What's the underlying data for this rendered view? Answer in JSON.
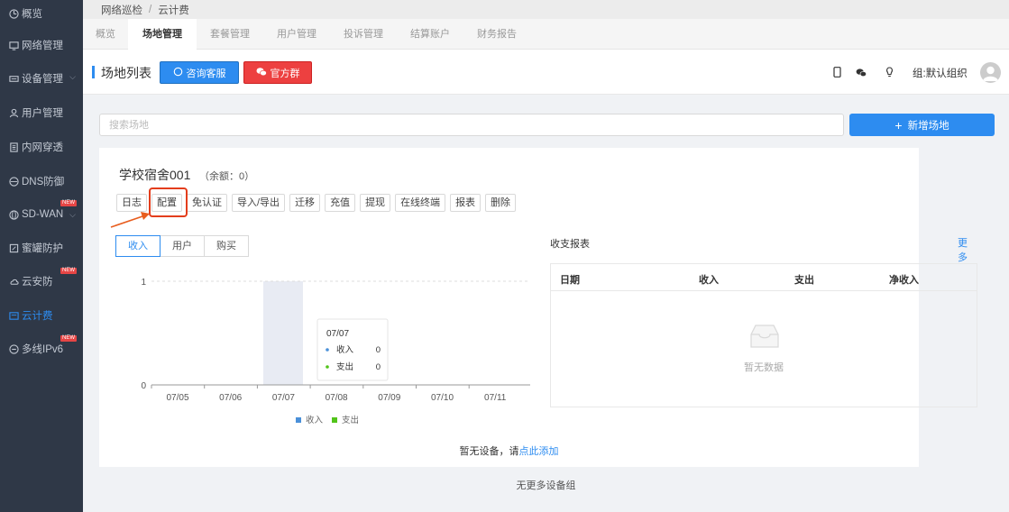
{
  "sidebar": {
    "items": [
      {
        "label": "概览",
        "icon": "dashboard-icon"
      },
      {
        "label": "网络管理",
        "icon": "monitor-icon"
      },
      {
        "label": "设备管理",
        "icon": "device-icon"
      },
      {
        "label": "用户管理",
        "icon": "user-icon"
      },
      {
        "label": "内网穿透",
        "icon": "tunnel-icon"
      },
      {
        "label": "DNS防御",
        "icon": "dns-icon"
      },
      {
        "label": "SD-WAN",
        "icon": "globe-icon"
      },
      {
        "label": "蜜罐防护",
        "icon": "honeypot-icon"
      },
      {
        "label": "云安防",
        "icon": "cloud-icon"
      },
      {
        "label": "云计费",
        "icon": "billing-icon"
      },
      {
        "label": "多线IPv6",
        "icon": "ipv6-icon"
      }
    ],
    "badge_label": "NEW",
    "active_color": "#2d8cf0"
  },
  "breadcrumb": {
    "parent": "网络巡检",
    "separator": "/",
    "current": "云计费"
  },
  "tabs": [
    "概览",
    "场地管理",
    "套餐管理",
    "用户管理",
    "投诉管理",
    "结算账户",
    "财务报告"
  ],
  "header": {
    "title": "场地列表",
    "consult_button": "咨询客服",
    "group_button": "官方群",
    "org_label": "组:默认组织"
  },
  "search": {
    "placeholder": "搜索场地"
  },
  "add_button": "新增场地",
  "venue": {
    "name": "学校宿舍001",
    "balance": "（余额：0）",
    "actions": [
      "日志",
      "配置",
      "免认证",
      "导入/导出",
      "迁移",
      "充值",
      "提现",
      "在线终端",
      "报表",
      "删除"
    ],
    "segments": [
      "收入",
      "用户",
      "购买"
    ]
  },
  "chart_data": {
    "type": "bar",
    "categories": [
      "07/05",
      "07/06",
      "07/07",
      "07/08",
      "07/09",
      "07/10",
      "07/11"
    ],
    "series": [
      {
        "name": "收入",
        "values": [
          0,
          0,
          0,
          0,
          0,
          0,
          0
        ],
        "color": "#4a90d9"
      },
      {
        "name": "支出",
        "values": [
          0,
          0,
          0,
          0,
          0,
          0,
          0
        ],
        "color": "#52c41a"
      }
    ],
    "ylim": [
      0,
      1
    ],
    "yticks": [
      "0",
      "1"
    ],
    "legend": "bottom",
    "tooltip": {
      "date": "07/07",
      "rows": [
        {
          "label": "收入",
          "value": "0"
        },
        {
          "label": "支出",
          "value": "0"
        }
      ]
    }
  },
  "report": {
    "title": "收支报表",
    "more": "更多",
    "columns": [
      "日期",
      "收入",
      "支出",
      "净收入"
    ],
    "empty": "暂无数据"
  },
  "footer": {
    "no_device": "暂无设备，请",
    "add_link": "点此添加",
    "no_more": "无更多设备组"
  }
}
